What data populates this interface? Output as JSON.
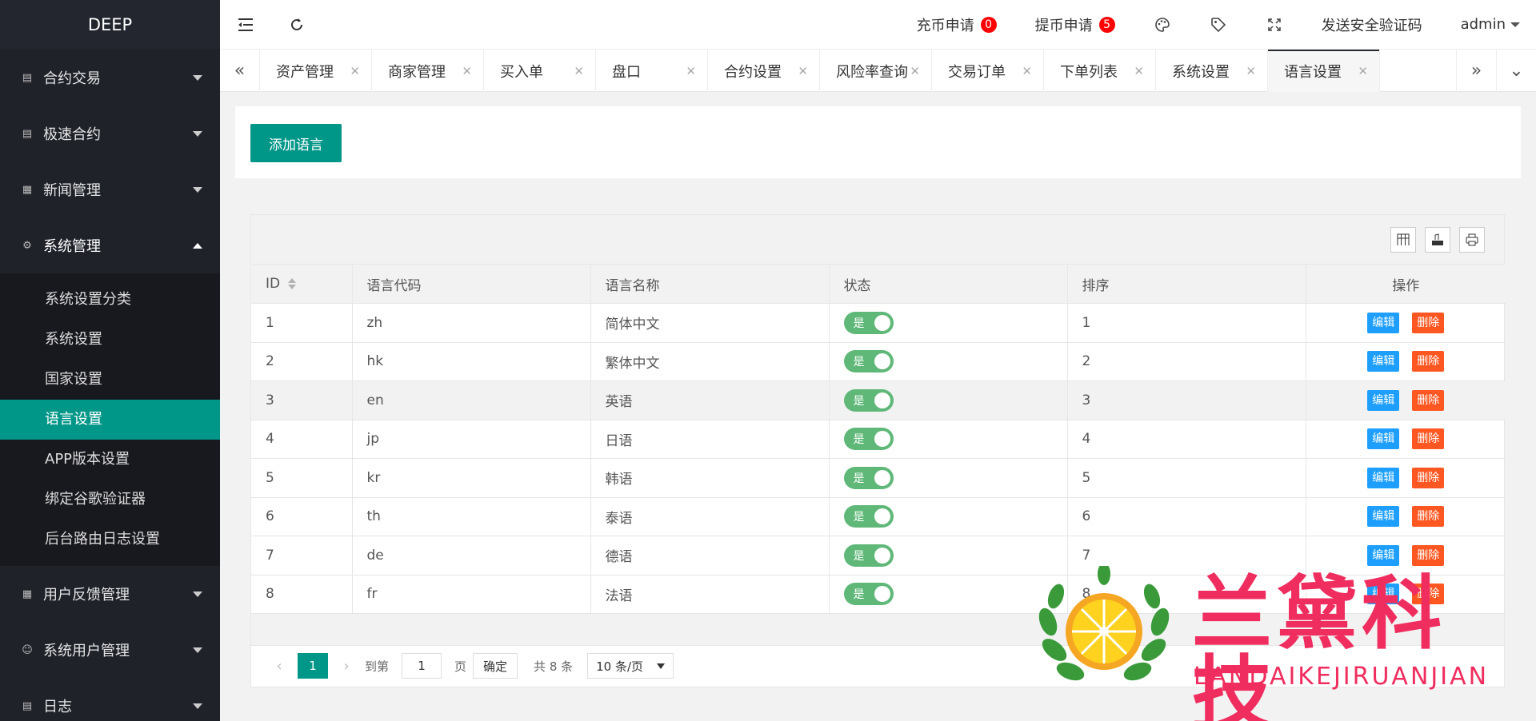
{
  "sidebar": {
    "logo": "DEEP",
    "menu": [
      {
        "label": "合约交易",
        "icon": "doc-icon"
      },
      {
        "label": "极速合约",
        "icon": "doc-icon"
      },
      {
        "label": "新闻管理",
        "icon": "news-icon"
      },
      {
        "label": "系统管理",
        "icon": "gear-icon"
      }
    ],
    "submenu": [
      "系统设置分类",
      "系统设置",
      "国家设置",
      "语言设置",
      "APP版本设置",
      "绑定谷歌验证器",
      "后台路由日志设置"
    ],
    "menu_after": [
      {
        "label": "用户反馈管理",
        "icon": "news-icon"
      },
      {
        "label": "系统用户管理",
        "icon": "user-icon"
      },
      {
        "label": "日志",
        "icon": "doc-icon"
      }
    ]
  },
  "header": {
    "deposit_label": "充币申请",
    "deposit_count": "0",
    "withdraw_label": "提币申请",
    "withdraw_count": "5",
    "send_code": "发送安全验证码",
    "user": "admin"
  },
  "tabs": [
    "资产管理",
    "商家管理",
    "买入单",
    "盘口",
    "合约设置",
    "风险率查询",
    "交易订单",
    "下单列表",
    "系统设置",
    "语言设置"
  ],
  "content": {
    "add_button": "添加语言",
    "columns": [
      "ID",
      "语言代码",
      "语言名称",
      "状态",
      "排序",
      "操作"
    ],
    "rows": [
      {
        "id": "1",
        "code": "zh",
        "name": "简体中文",
        "status": "是",
        "sort": "1"
      },
      {
        "id": "2",
        "code": "hk",
        "name": "繁体中文",
        "status": "是",
        "sort": "2"
      },
      {
        "id": "3",
        "code": "en",
        "name": "英语",
        "status": "是",
        "sort": "3"
      },
      {
        "id": "4",
        "code": "jp",
        "name": "日语",
        "status": "是",
        "sort": "4"
      },
      {
        "id": "5",
        "code": "kr",
        "name": "韩语",
        "status": "是",
        "sort": "5"
      },
      {
        "id": "6",
        "code": "th",
        "name": "泰语",
        "status": "是",
        "sort": "6"
      },
      {
        "id": "7",
        "code": "de",
        "name": "德语",
        "status": "是",
        "sort": "7"
      },
      {
        "id": "8",
        "code": "fr",
        "name": "法语",
        "status": "是",
        "sort": "8"
      }
    ],
    "edit_label": "编辑",
    "delete_label": "删除"
  },
  "pager": {
    "current": "1",
    "goto_label": "到第",
    "page_input": "1",
    "page_unit": "页",
    "confirm": "确定",
    "total": "共 8 条",
    "per_page": "10 条/页"
  },
  "watermark": {
    "title": "兰黛科技",
    "subtitle": "LANDAIKEJIRUANJIAN"
  },
  "colors": {
    "accent": "#009688",
    "sidebar": "#20222a",
    "edit": "#1e9fff",
    "delete": "#ff5722",
    "switch_on": "#5fb878",
    "watermark": "#ef2d5e"
  }
}
